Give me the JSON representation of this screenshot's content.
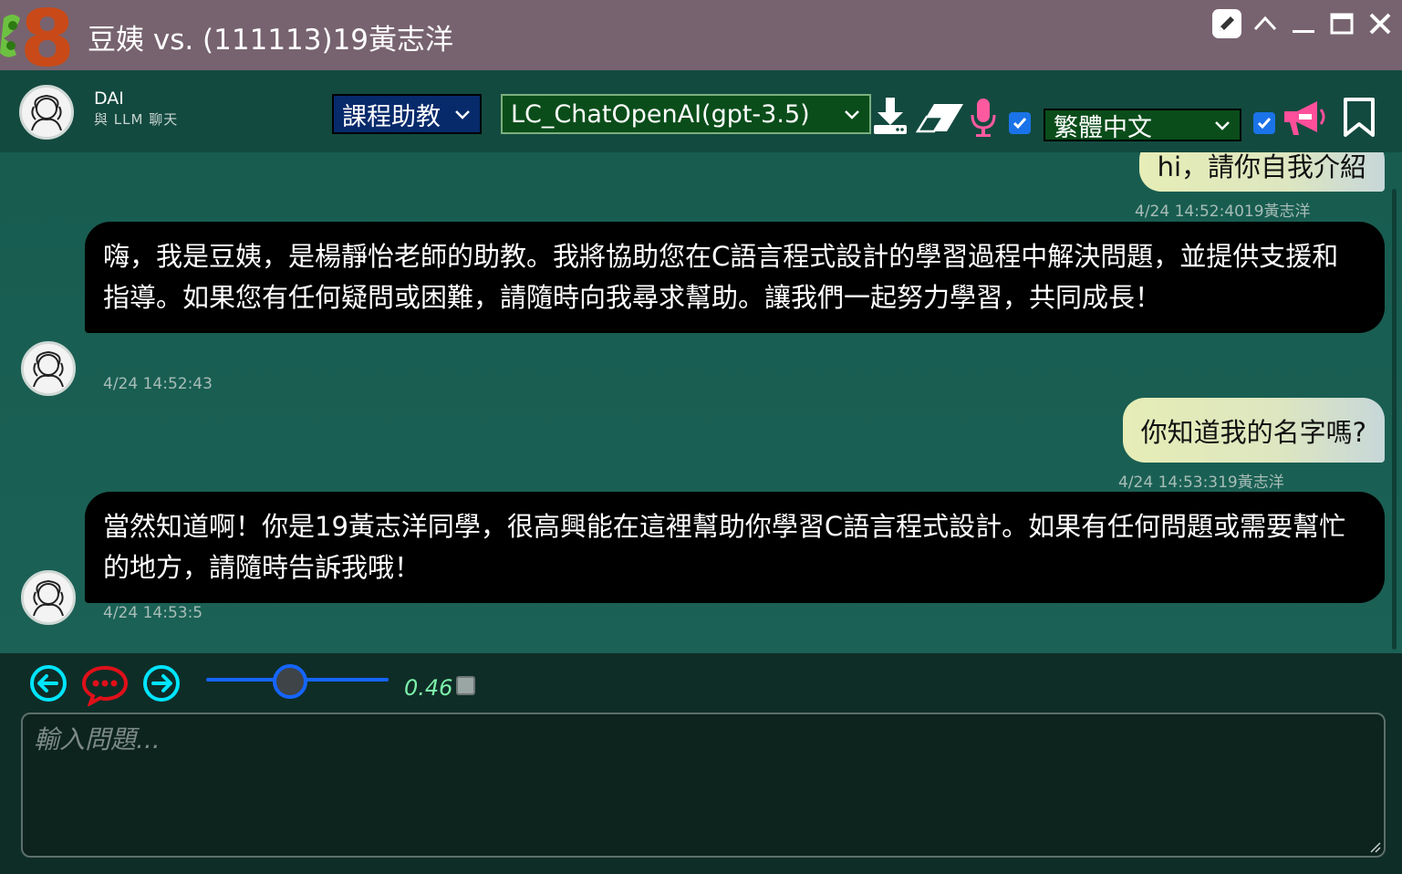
{
  "window": {
    "title": "豆姨 vs. (111113)19黃志洋",
    "logo_text": "8"
  },
  "header": {
    "bot_name": "DAI",
    "bot_subtitle": "與 LLM 聊天",
    "role_select": "課程助教",
    "model_select": "LC_ChatOpenAI(gpt-3.5)",
    "language_select": "繁體中文",
    "checkbox_1_checked": true,
    "checkbox_2_checked": true
  },
  "messages": [
    {
      "role": "user",
      "text": "hi，請你自我介紹",
      "timestamp": "4/24 14:52:4019黃志洋"
    },
    {
      "role": "bot",
      "text": "嗨，我是豆姨，是楊靜怡老師的助教。我將協助您在C語言程式設計的學習過程中解決問題，並提供支援和指導。如果您有任何疑問或困難，請隨時向我尋求幫助。讓我們一起努力學習，共同成長！",
      "timestamp": "4/24 14:52:43"
    },
    {
      "role": "user",
      "text": "你知道我的名字嗎?",
      "timestamp": "4/24 14:53:319黃志洋"
    },
    {
      "role": "bot",
      "text": "當然知道啊！你是19黃志洋同學，很高興能在這裡幫助你學習C語言程式設計。如果有任何問題或需要幫忙的地方，請隨時告訴我哦！",
      "timestamp": "4/24 14:53:5"
    }
  ],
  "controls": {
    "temperature": "0.46",
    "temperature_value": 0.46,
    "input_placeholder": "輸入問題..."
  },
  "colors": {
    "titlebar": "#77636f",
    "header": "#134a3f",
    "chat_bg": "#185c50",
    "bot_bubble": "#000000",
    "user_bubble": "#e6edb6",
    "accent_blue": "#1565ff",
    "icon_cyan": "#00e5ff",
    "icon_pink": "#ff4f9a",
    "icon_red": "#e0101a"
  },
  "icons": [
    "pencil-icon",
    "chevron-up-icon",
    "minimize-icon",
    "maximize-icon",
    "close-icon",
    "download-icon",
    "eraser-icon",
    "microphone-icon",
    "megaphone-icon",
    "bookmark-icon",
    "arrow-left-icon",
    "chat-bubble-icon",
    "arrow-right-icon"
  ]
}
